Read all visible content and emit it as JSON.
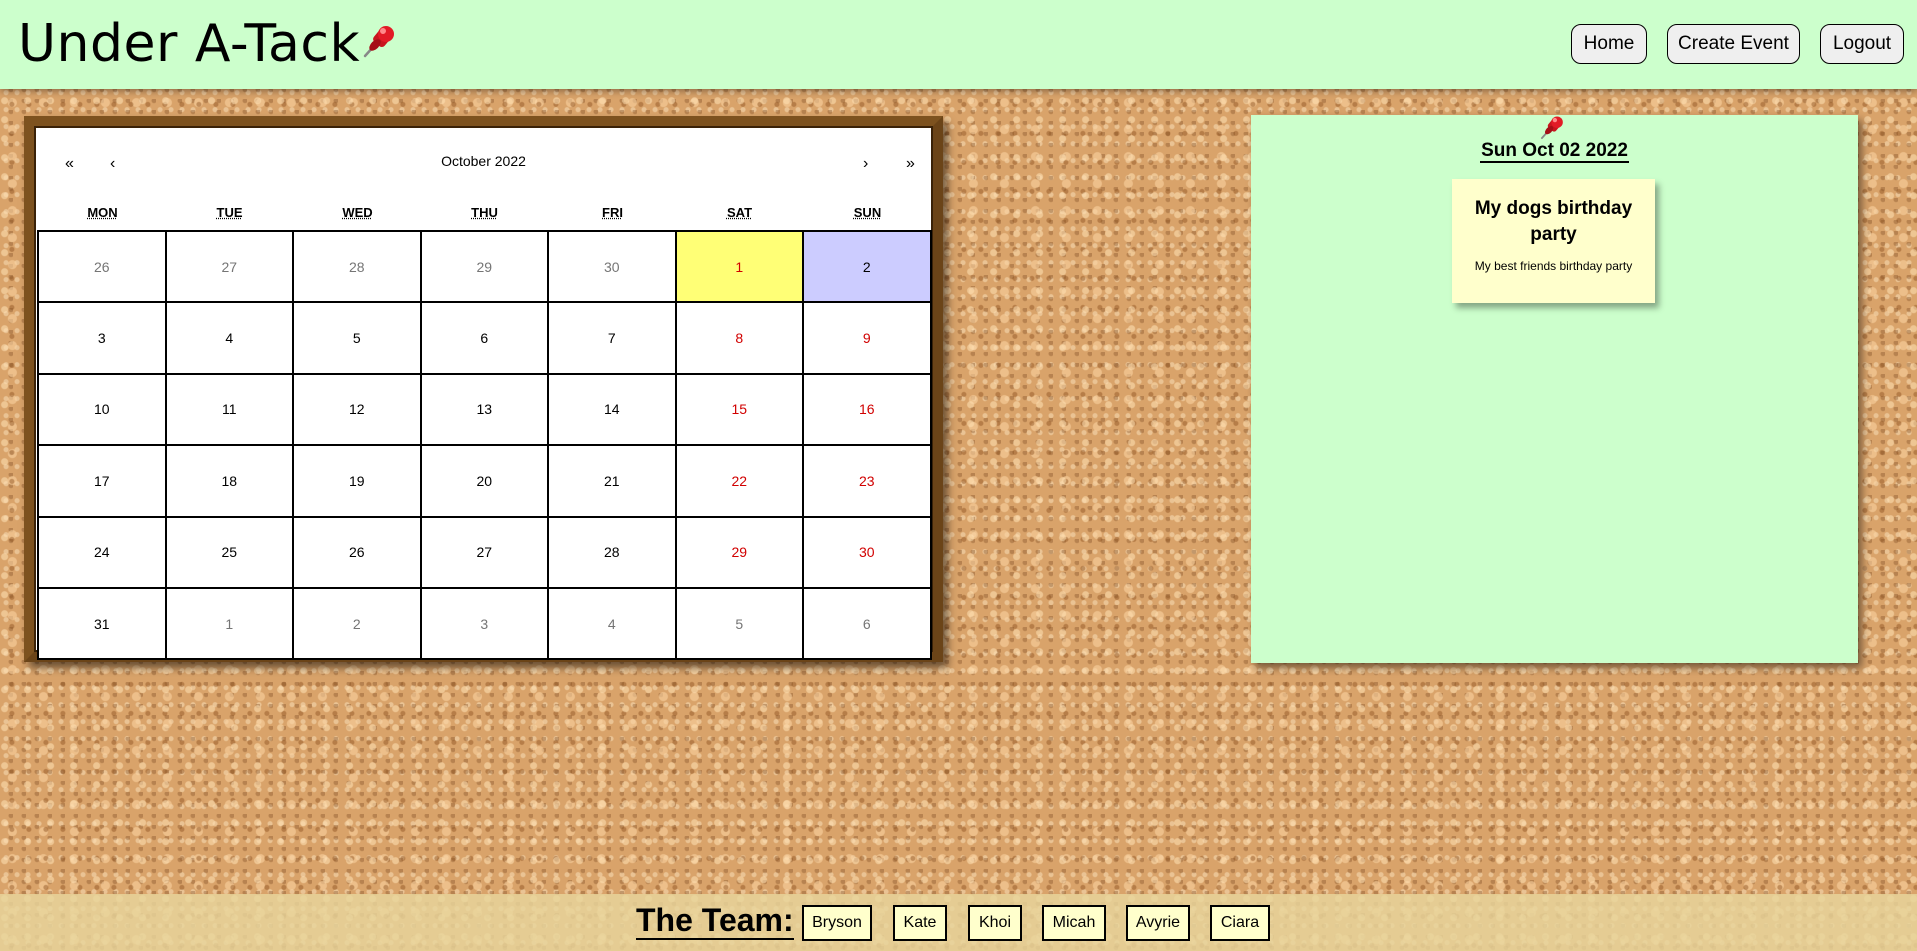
{
  "header": {
    "title": "Under A-Tack",
    "nav": {
      "home": "Home",
      "create_event": "Create Event",
      "logout": "Logout"
    }
  },
  "calendar": {
    "month_label": "October 2022",
    "nav": {
      "prev_year": "«",
      "prev_month": "‹",
      "next_month": "›",
      "next_year": "»"
    },
    "weekdays": [
      "MON",
      "TUE",
      "WED",
      "THU",
      "FRI",
      "SAT",
      "SUN"
    ],
    "weeks": [
      [
        "26",
        "27",
        "28",
        "29",
        "30",
        "1",
        "2"
      ],
      [
        "3",
        "4",
        "5",
        "6",
        "7",
        "8",
        "9"
      ],
      [
        "10",
        "11",
        "12",
        "13",
        "14",
        "15",
        "16"
      ],
      [
        "17",
        "18",
        "19",
        "20",
        "21",
        "22",
        "23"
      ],
      [
        "24",
        "25",
        "26",
        "27",
        "28",
        "29",
        "30"
      ],
      [
        "31",
        "1",
        "2",
        "3",
        "4",
        "5",
        "6"
      ]
    ]
  },
  "detail": {
    "date": "Sun Oct 02 2022",
    "event": {
      "title": "My dogs birthday party",
      "description": "My best friends birthday party"
    }
  },
  "footer": {
    "team_label": "The Team:",
    "members": [
      "Bryson",
      "Kate",
      "Khoi",
      "Micah",
      "Avyrie",
      "Ciara"
    ]
  },
  "colors": {
    "header_bg": "#ccffcc",
    "today_highlight": "#ffff76",
    "selected_highlight": "#ccccff",
    "weekend_text": "#d10000",
    "note_bg": "#ffffcc",
    "frame": "#6b4418"
  },
  "icons": {
    "title_pin": "pushpin-icon",
    "panel_pin": "pushpin-icon"
  }
}
